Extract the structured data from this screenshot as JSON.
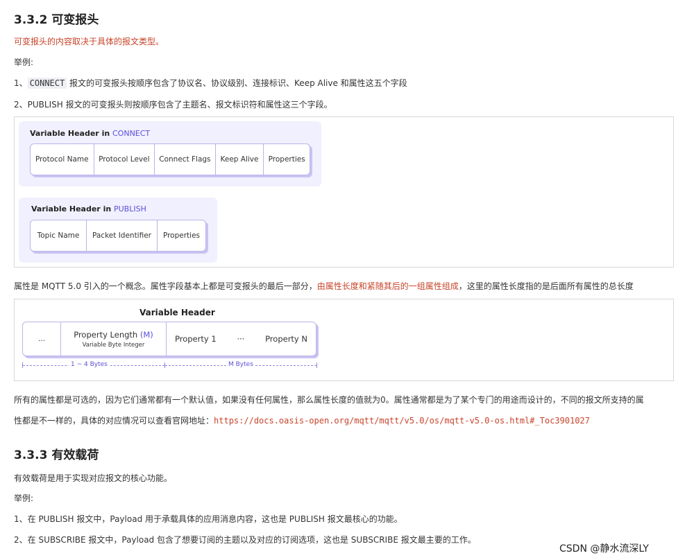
{
  "h_332": "3.3.2 可变报头",
  "subtitle_red": "可变报头的内容取决于具体的报文类型。",
  "example_label_1": "举例:",
  "line1": {
    "pre": "1、",
    "code": "CONNECT",
    "rest": " 报文的可变报头按顺序包含了协议名、协议级别、连接标识、Keep Alive 和属性这五个字段"
  },
  "line2": "2、PUBLISH 报文的可变报头则按顺序包含了主题名、报文标识符和属性这三个字段。",
  "figure1": {
    "connect": {
      "title_pre": "Variable Header in ",
      "title_acc": "CONNECT",
      "cells": [
        "Protocol Name",
        "Protocol Level",
        "Connect Flags",
        "Keep Alive",
        "Properties"
      ]
    },
    "publish": {
      "title_pre": "Variable Header in ",
      "title_acc": "PUBLISH",
      "cells": [
        "Topic Name",
        "Packet Identifier",
        "Properties"
      ]
    }
  },
  "props_para": {
    "pre": "属性是 MQTT 5.0 引入的一个概念。属性字段基本上都是可变报头的最后一部分，",
    "red": "由属性长度和紧随其后的一组属性组成",
    "post": "，这里的属性长度指的是后面所有属性的总长度"
  },
  "figure2": {
    "title": "Variable Header",
    "cell_dots": "...",
    "prop_len": "Property Length ",
    "prop_len_acc": "(M)",
    "var_byte": "Variable Byte Integer",
    "prop1": "Property 1",
    "dots2": "···",
    "propN": "Property N",
    "dim1": "1 ~ 4 Bytes",
    "dim2": "M Bytes"
  },
  "para_all_optional_1": "所有的属性都是可选的，因为它们通常都有一个默认值，如果没有任何属性，那么属性长度的值就为0。属性通常都是为了某个专门的用途而设计的，不同的报文所支持的属",
  "para_all_optional_2": "性都是不一样的，具体的对应情况可以查看官网地址：",
  "url": "https://docs.oasis-open.org/mqtt/mqtt/v5.0/os/mqtt-v5.0-os.html#_Toc3901027",
  "h_333": "3.3.3 有效载荷",
  "payload_desc": "有效载荷是用于实现对应报文的核心功能。",
  "example_label_2": "举例:",
  "p_line1": "1、在 PUBLISH 报文中，Payload 用于承载具体的应用消息内容，这也是 PUBLISH 报文最核心的功能。",
  "p_line2": "2、在 SUBSCRIBE 报文中，Payload 包含了想要订阅的主题以及对应的订阅选项，这也是 SUBSCRIBE 报文最主要的工作。",
  "watermark": "CSDN @静水流深LY"
}
